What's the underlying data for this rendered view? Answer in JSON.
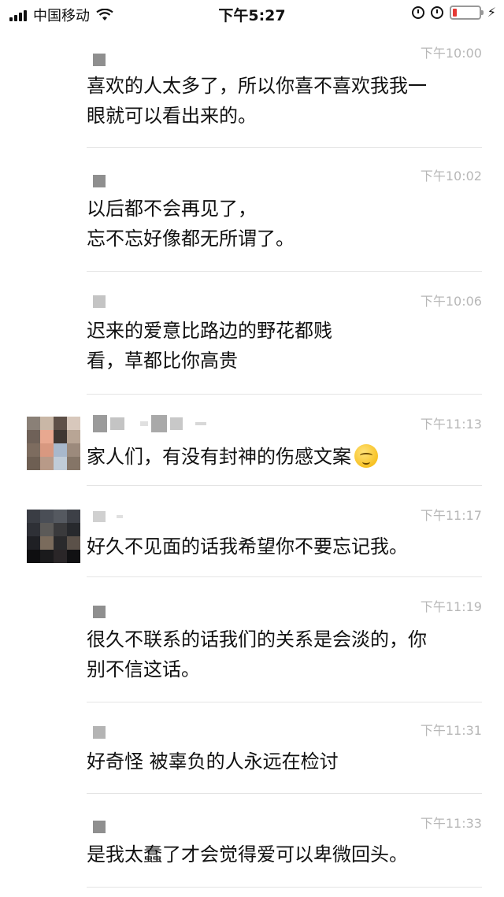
{
  "status_bar": {
    "carrier": "中国移动",
    "time": "下午5:27"
  },
  "comments": [
    {
      "time": "下午10:00",
      "text": "喜欢的人太多了，所以你喜不喜欢我我一\n眼就可以看出来的。"
    },
    {
      "time": "下午10:02",
      "text": "以后都不会再见了，\n忘不忘好像都无所谓了。"
    },
    {
      "time": "下午10:06",
      "text": "迟来的爱意比路边的野花都贱\n看，草都比你高贵"
    },
    {
      "time": "下午11:13",
      "text": "家人们，有没有封神的伤感文案"
    },
    {
      "time": "下午11:17",
      "text": "好久不见面的话我希望你不要忘记我。"
    },
    {
      "time": "下午11:19",
      "text": "很久不联系的话我们的关系是会淡的，你\n别不信这话。"
    },
    {
      "time": "下午11:31",
      "text": "好奇怪 被辜负的人永远在检讨"
    },
    {
      "time": "下午11:33",
      "text": "是我太蠢了才会觉得爱可以卑微回头。"
    }
  ],
  "colors": {
    "time_gray": "#b7b7b7",
    "divider": "#e4e4e4",
    "battery_red": "#e53935"
  }
}
